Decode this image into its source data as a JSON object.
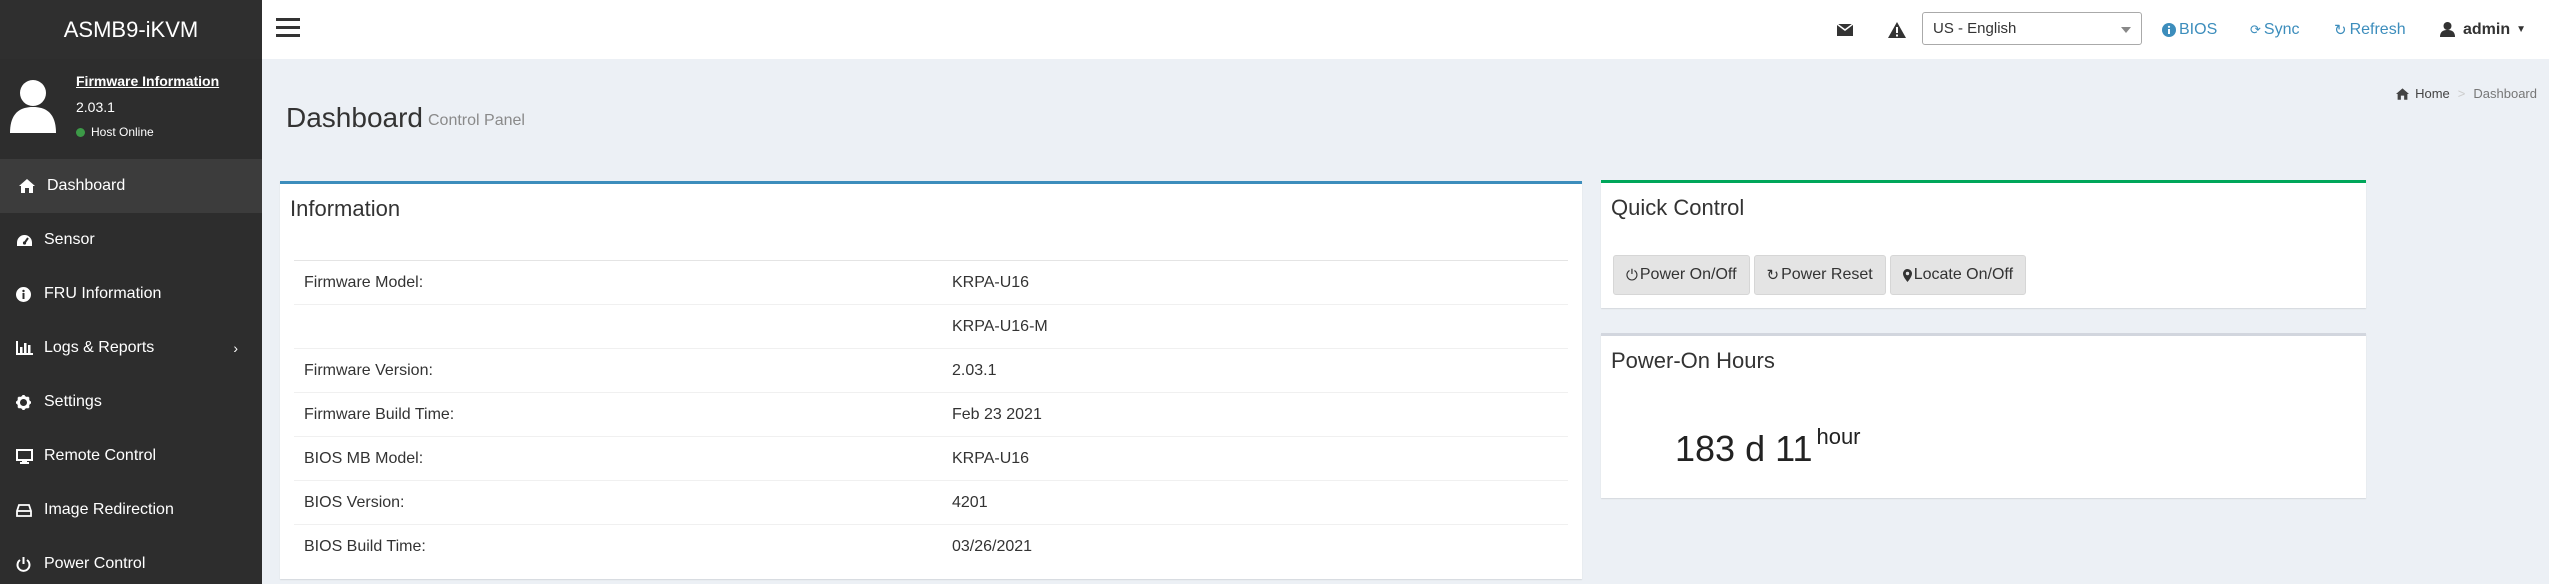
{
  "app": {
    "title": "ASMB9-iKVM"
  },
  "user_panel": {
    "firmware_link": "Firmware Information",
    "firmware_version": "2.03.1",
    "status": "Host Online",
    "status_color": "#3c9a47"
  },
  "sidebar": {
    "items": [
      {
        "label": "Dashboard",
        "icon": "home-icon"
      },
      {
        "label": "Sensor",
        "icon": "dashboard-gauge-icon"
      },
      {
        "label": "FRU Information",
        "icon": "info-circle-icon"
      },
      {
        "label": "Logs & Reports",
        "icon": "bar-chart-icon"
      },
      {
        "label": "Settings",
        "icon": "gear-icon"
      },
      {
        "label": "Remote Control",
        "icon": "desktop-icon"
      },
      {
        "label": "Image Redirection",
        "icon": "disk-icon"
      },
      {
        "label": "Power Control",
        "icon": "power-icon"
      }
    ]
  },
  "topbar": {
    "language": "US - English",
    "bios_label": "BIOS",
    "sync_label": "Sync",
    "refresh_label": "Refresh",
    "user_label": "admin",
    "accent_color": "#3c8dbc"
  },
  "header": {
    "title": "Dashboard",
    "subtitle": "Control Panel",
    "breadcrumb": [
      "Home",
      "Dashboard"
    ]
  },
  "information": {
    "title": "Information",
    "rows": [
      {
        "label": "Firmware Model:",
        "value": "KRPA-U16"
      },
      {
        "label": "",
        "value": "KRPA-U16-M"
      },
      {
        "label": "Firmware Version:",
        "value": "2.03.1"
      },
      {
        "label": "Firmware Build Time:",
        "value": "Feb 23 2021"
      },
      {
        "label": "BIOS MB Model:",
        "value": "KRPA-U16"
      },
      {
        "label": "BIOS Version:",
        "value": "4201"
      },
      {
        "label": "BIOS Build Time:",
        "value": "03/26/2021"
      }
    ]
  },
  "quick_control": {
    "title": "Quick Control",
    "buttons": [
      "Power On/Off",
      "Power Reset",
      "Locate On/Off"
    ]
  },
  "power_on_hours": {
    "title": "Power-On Hours",
    "value": "183 d 11",
    "unit": "hour"
  }
}
